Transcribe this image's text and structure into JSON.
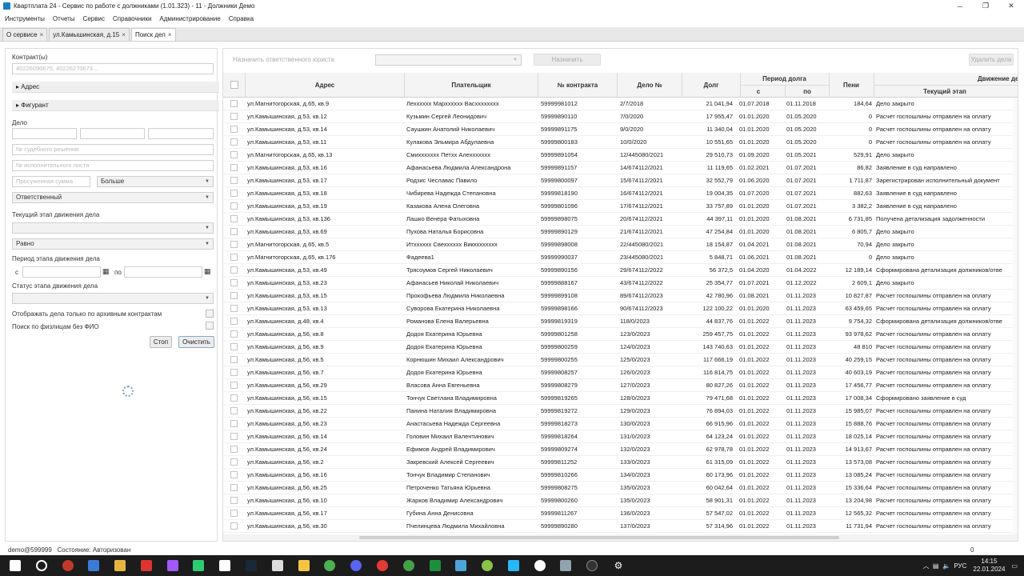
{
  "window": {
    "title": "Квартплата 24 - Сервис по работе с должниками (1.01.323) - 11 - Должники Демо"
  },
  "menu": [
    "Инструменты",
    "Отчеты",
    "Сервис",
    "Справочники",
    "Администрирование",
    "Справка"
  ],
  "tabs": [
    {
      "label": "О сервисе",
      "close": "×"
    },
    {
      "label": "ул.Камышинская, д.15",
      "close": "×"
    },
    {
      "label": "Поиск дел",
      "close": "×"
    }
  ],
  "filters": {
    "contract_label": "Контракт(ы)",
    "contract_placeholder": "40226090675, 40226270673...",
    "address_label": "Адрес",
    "figurant_label": "Фигурант",
    "case_label": "Дело",
    "court_decision_placeholder": "№ судебного решения",
    "writ_placeholder": "№ исполнительного листа",
    "overdue_placeholder": "Просуженная сумма",
    "compare_value": "Больше",
    "responsible_value": "Ответственный",
    "stage_label": "Текущий этап движения дела",
    "equal_value": "Равно",
    "period_label": "Период этапа движения дела",
    "from_label": "с",
    "to_label": "по",
    "status_label": "Статус этапа движения дела",
    "archive_label": "Отображать дела только по архивным контрактам",
    "noname_label": "Поиск по физлицам без ФИО",
    "stop_button": "Стоп",
    "clear_button": "Очистить"
  },
  "toolbar": {
    "assign_lawyer": "Назначить ответственного юриста",
    "assign_button": "Назначить",
    "delete_button": "Удалить дела"
  },
  "columns": {
    "address": "Адрес",
    "payer": "Плательщик",
    "contract": "№ контракта",
    "case": "Дело №",
    "debt": "Долг",
    "period": "Период долга",
    "from": "с",
    "to": "по",
    "penalty": "Пени",
    "movement": "Движение дела",
    "stage": "Текущий этап"
  },
  "rows": [
    {
      "address": "ул.Магнитогорская, д.65, кв.9",
      "payer": "Лехххххх Мархххххх Васхххххххх",
      "contract": "59999981012",
      "case": "2/7/2018",
      "debt": "21 041,94",
      "from": "01.07.2018",
      "to": "01.11.2018",
      "penalty": "184,64",
      "stage": "Дело закрыто"
    },
    {
      "address": "ул.Камышинская, д.53, кв.12",
      "payer": "Кузьмин Сергей Леонидович",
      "contract": "59999890110",
      "case": "7/0/2020",
      "debt": "17 955,47",
      "from": "01.01.2020",
      "to": "01.05.2020",
      "penalty": "0",
      "stage": "Расчет госпошлины отправлен на оплату"
    },
    {
      "address": "ул.Камышинская, д.53, кв.14",
      "payer": "Саушкин Анатолий Николаевич",
      "contract": "59999891175",
      "case": "9/0/2020",
      "debt": "11 340,04",
      "from": "01.01.2020",
      "to": "01.05.2020",
      "penalty": "0",
      "stage": "Расчет госпошлины отправлен на оплату"
    },
    {
      "address": "ул.Камышинская, д.53, кв.11",
      "payer": "Кулакова Эльмира Абдулаевна",
      "contract": "59999800183",
      "case": "10/0/2020",
      "debt": "10 551,65",
      "from": "01.01.2020",
      "to": "01.05.2020",
      "penalty": "0",
      "stage": "Расчет госпошлины отправлен на оплату"
    },
    {
      "address": "ул.Магнитогорская, д.65, кв.13",
      "payer": "Смиххххххх Петхх Алеххххххх",
      "contract": "59999891054",
      "case": "12/445080/2021",
      "debt": "29 510,73",
      "from": "01.09.2020",
      "to": "01.05.2021",
      "penalty": "529,91",
      "stage": "Дело закрыто"
    },
    {
      "address": "ул.Камышинская, д.53, кв.16",
      "payer": "Афанасьева Людмила Александрона",
      "contract": "59999891157",
      "case": "14/674112/2021",
      "debt": "11 119,65",
      "from": "01.02.2021",
      "to": "01.07.2021",
      "penalty": "86,82",
      "stage": "Заявление в суд направлено"
    },
    {
      "address": "ул.Камышинская, д.53, кв.17",
      "payer": "Родзис Чеславас Павило",
      "contract": "59999800097",
      "case": "15/674112/2021",
      "debt": "32 552,79",
      "from": "01.06.2020",
      "to": "01.07.2021",
      "penalty": "1 711,87",
      "stage": "Зарегистрирован исполнительный документ"
    },
    {
      "address": "ул.Камышинская, д.53, кв.18",
      "payer": "Чибирева Надежда Степановна",
      "contract": "59999818190",
      "case": "16/674112/2021",
      "debt": "19 004,35",
      "from": "01.07.2020",
      "to": "01.07.2021",
      "penalty": "882,63",
      "stage": "Заявление в суд направлено"
    },
    {
      "address": "ул.Камышинская, д.53, кв.19",
      "payer": "Казакова Алена Олеговна",
      "contract": "59999801096",
      "case": "17/674112/2021",
      "debt": "33 757,89",
      "from": "01.01.2020",
      "to": "01.07.2021",
      "penalty": "3 382,2",
      "stage": "Заявление в суд направлено"
    },
    {
      "address": "ул.Камышинская, д.53, кв.136",
      "payer": "Лашко Венера Фатыховна",
      "contract": "59999898075",
      "case": "20/674112/2021",
      "debt": "44 397,11",
      "from": "01.01.2020",
      "to": "01.08.2021",
      "penalty": "6 731,85",
      "stage": "Получена детализация задолженности"
    },
    {
      "address": "ул.Камышинская, д.53, кв.69",
      "payer": "Пухова Наталья Борисовна",
      "contract": "59999890129",
      "case": "21/674112/2021",
      "debt": "47 254,84",
      "from": "01.01.2020",
      "to": "01.08.2021",
      "penalty": "6 805,7",
      "stage": "Дело закрыто"
    },
    {
      "address": "ул.Магнитогорская, д.65, кв.5",
      "payer": "Итхххххх Свехххххх Викхххххххх",
      "contract": "59999898008",
      "case": "22/445080/2021",
      "debt": "18 154,87",
      "from": "01.04.2021",
      "to": "01.08.2021",
      "penalty": "70,94",
      "stage": "Дело закрыто"
    },
    {
      "address": "ул.Магнитогорская, д.65, кв.176",
      "payer": "Фадеева1",
      "contract": "59999990037",
      "case": "23/445080/2021",
      "debt": "5 848,71",
      "from": "01.06.2021",
      "to": "01.08.2021",
      "penalty": "0",
      "stage": "Дело закрыто"
    },
    {
      "address": "ул.Камышинская, д.53, кв.49",
      "payer": "Трясоумов Сергей Николаевич",
      "contract": "59999890156",
      "case": "29/674112/2022",
      "debt": "56 372,5",
      "from": "01.04.2020",
      "to": "01.04.2022",
      "penalty": "12 189,14",
      "stage": "Сформирована детализация должников/отве"
    },
    {
      "address": "ул.Камышинская, д.53, кв.23",
      "payer": "Афанасьев Николай Николаевич",
      "contract": "59999888167",
      "case": "43/674112/2022",
      "debt": "25 354,77",
      "from": "01.07.2021",
      "to": "01.12.2022",
      "penalty": "2 609,1",
      "stage": "Дело закрыто"
    },
    {
      "address": "ул.Камышинская, д.53, кв.15",
      "payer": "Прокофьева Людмила Николаевна",
      "contract": "59999899108",
      "case": "89/674112/2023",
      "debt": "42 780,96",
      "from": "01.08.2021",
      "to": "01.11.2023",
      "penalty": "10 827,87",
      "stage": "Расчет госпошлины отправлен на оплату"
    },
    {
      "address": "ул.Камышинская, д.53, кв.13",
      "payer": "Суворова Екатерина Николаевна",
      "contract": "59999898166",
      "case": "90/674112/2023",
      "debt": "122 100,22",
      "from": "01.01.2020",
      "to": "01.11.2023",
      "penalty": "63 459,65",
      "stage": "Расчет госпошлины отправлен на оплату"
    },
    {
      "address": "ул.Камышинская, д.48, кв.4",
      "payer": "Романова Елена Валерьевна",
      "contract": "59999819319",
      "case": "118/0/2023",
      "debt": "44 837,76",
      "from": "01.01.2022",
      "to": "01.11.2023",
      "penalty": "9 754,32",
      "stage": "Сформирована детализация должников/отве"
    },
    {
      "address": "ул.Камышинская, д.56, кв.8",
      "payer": "Додоя Екатерина Юрьевна",
      "contract": "59999801258",
      "case": "123/0/2023",
      "debt": "259 457,75",
      "from": "01.01.2022",
      "to": "01.11.2023",
      "penalty": "93 978,62",
      "stage": "Расчет госпошлины отправлен на оплату"
    },
    {
      "address": "ул.Камышинская, д.56, кв.9",
      "payer": "Додоя Екатерина Юрьевна",
      "contract": "59999800259",
      "case": "124/0/2023",
      "debt": "143 740,63",
      "from": "01.01.2022",
      "to": "01.11.2023",
      "penalty": "48 810",
      "stage": "Расчет госпошлины отправлен на оплату"
    },
    {
      "address": "ул.Камышинская, д.56, кв.5",
      "payer": "Корнюшин Михаил Александрович",
      "contract": "59999800255",
      "case": "125/0/2023",
      "debt": "117 666,19",
      "from": "01.01.2022",
      "to": "01.11.2023",
      "penalty": "40 259,15",
      "stage": "Расчет госпошлины отправлен на оплату"
    },
    {
      "address": "ул.Камышинская, д.56, кв.7",
      "payer": "Додоя Екатерина Юрьевна",
      "contract": "59999808257",
      "case": "126/0/2023",
      "debt": "116 814,75",
      "from": "01.01.2022",
      "to": "01.11.2023",
      "penalty": "40 603,19",
      "stage": "Расчет госпошлины отправлен на оплату"
    },
    {
      "address": "ул.Камышинская, д.56, кв.29",
      "payer": "Власова Анна Евгеньевна",
      "contract": "59999808279",
      "case": "127/0/2023",
      "debt": "80 827,26",
      "from": "01.01.2022",
      "to": "01.11.2023",
      "penalty": "17 456,77",
      "stage": "Расчет госпошлины отправлен на оплату"
    },
    {
      "address": "ул.Камышинская, д.56, кв.15",
      "payer": "Тончук Светлана Владимировна",
      "contract": "59999819265",
      "case": "128/0/2023",
      "debt": "79 471,68",
      "from": "01.01.2022",
      "to": "01.11.2023",
      "penalty": "17 008,34",
      "stage": "Сформировано заявление в суд"
    },
    {
      "address": "ул.Камышинская, д.56, кв.22",
      "payer": "Панина Наталия Владимировна",
      "contract": "59999819272",
      "case": "129/0/2023",
      "debt": "76 894,03",
      "from": "01.01.2022",
      "to": "01.11.2023",
      "penalty": "15 985,07",
      "stage": "Расчет госпошлины отправлен на оплату"
    },
    {
      "address": "ул.Камышинская, д.56, кв.23",
      "payer": "Анастасьева Надежда Сергеевна",
      "contract": "59999818273",
      "case": "130/0/2023",
      "debt": "66 915,96",
      "from": "01.01.2022",
      "to": "01.11.2023",
      "penalty": "15 888,76",
      "stage": "Расчет госпошлины отправлен на оплату"
    },
    {
      "address": "ул.Камышинская, д.56, кв.14",
      "payer": "Головин Михаил Валентинович",
      "contract": "59999818264",
      "case": "131/0/2023",
      "debt": "64 123,24",
      "from": "01.01.2022",
      "to": "01.11.2023",
      "penalty": "18 025,14",
      "stage": "Расчет госпошлины отправлен на оплату"
    },
    {
      "address": "ул.Камышинская, д.56, кв.24",
      "payer": "Ефимов Андрей Владимирович",
      "contract": "59999809274",
      "case": "132/0/2023",
      "debt": "62 978,78",
      "from": "01.01.2022",
      "to": "01.11.2023",
      "penalty": "14 913,67",
      "stage": "Расчет госпошлины отправлен на оплату"
    },
    {
      "address": "ул.Камышинская, д.56, кв.2",
      "payer": "Закревский Алексей Сергеевич",
      "contract": "59999811252",
      "case": "133/0/2023",
      "debt": "61 315,09",
      "from": "01.01.2022",
      "to": "01.11.2023",
      "penalty": "13 573,08",
      "stage": "Расчет госпошлины отправлен на оплату"
    },
    {
      "address": "ул.Камышинская, д.56, кв.16",
      "payer": "Тончук Владимир Степанович",
      "contract": "59999810266",
      "case": "134/0/2023",
      "debt": "60 173,96",
      "from": "01.01.2022",
      "to": "01.11.2023",
      "penalty": "13 085,24",
      "stage": "Расчет госпошлины отправлен на оплату"
    },
    {
      "address": "ул.Камышинская, д.56, кв.25",
      "payer": "Петроченко Татьяна Юрьевна",
      "contract": "59999808275",
      "case": "135/0/2023",
      "debt": "60 042,64",
      "from": "01.01.2022",
      "to": "01.11.2023",
      "penalty": "15 336,64",
      "stage": "Расчет госпошлины отправлен на оплату"
    },
    {
      "address": "ул.Камышинская, д.56, кв.10",
      "payer": "Жарков Владимир Александрович",
      "contract": "59999800260",
      "case": "135/0/2023",
      "debt": "58 901,31",
      "from": "01.01.2022",
      "to": "01.11.2023",
      "penalty": "13 204,98",
      "stage": "Расчет госпошлины отправлен на оплату"
    },
    {
      "address": "ул.Камышинская, д.56, кв.17",
      "payer": "Губина Анна Денисовна",
      "contract": "59999811267",
      "case": "136/0/2023",
      "debt": "57 547,02",
      "from": "01.01.2022",
      "to": "01.11.2023",
      "penalty": "12 565,32",
      "stage": "Расчет госпошлины отправлен на оплату"
    },
    {
      "address": "ул.Камышинская, д.56, кв.30",
      "payer": "Пчелинцева Людмила Михайловна",
      "contract": "59999890280",
      "case": "137/0/2023",
      "debt": "57 314,96",
      "from": "01.01.2022",
      "to": "01.11.2023",
      "penalty": "11 731,94",
      "stage": "Расчет госпошлины отправлен на оплату"
    }
  ],
  "status": {
    "user": "demo@599999",
    "state": "Состояние: Авторизован",
    "count": "0"
  },
  "taskbar": {
    "lang": "РУС",
    "time": "14:15",
    "date": "22.01.2024"
  }
}
